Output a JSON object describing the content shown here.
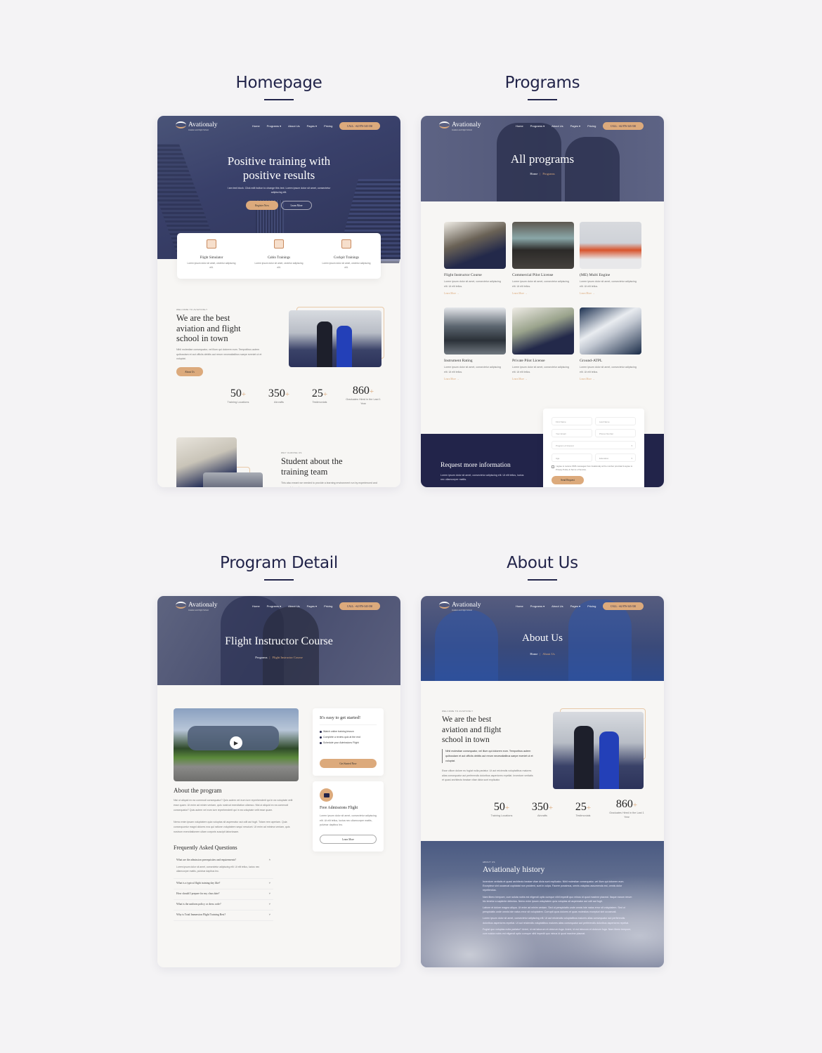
{
  "colors": {
    "navy": "#22244a",
    "accent": "#dcaa7c",
    "background": "#f4f3f5"
  },
  "sections": {
    "homepage": "Homepage",
    "programs": "Programs",
    "program_detail": "Program Detail",
    "about": "About Us"
  },
  "nav": {
    "logo": "Avationaly",
    "logo_sub": "Aviation and Flight School",
    "items": [
      "Home",
      "Programs ▾",
      "About Us",
      "Pages ▾",
      "Pricing"
    ],
    "call": "CALL: +62 876-343-330"
  },
  "homepage": {
    "hero_title_1": "Positive training with",
    "hero_title_2": "positive results",
    "hero_text": "I am text block. Click edit button to change this text. Lorem ipsum dolor sit amet, consectetur adipiscing elit.",
    "register": "Register Now",
    "learn": "Learn More",
    "features": [
      {
        "icon": "flight-simulator-icon",
        "title": "Flight Simulator",
        "text": "Lorem ipsum dolor sit amet, cectetur adipiscing elit."
      },
      {
        "icon": "cabin-seats-icon",
        "title": "Cabin Trainings",
        "text": "Lorem ipsum dolor sit amet, cectetur adipiscing elit."
      },
      {
        "icon": "cockpit-icon",
        "title": "Cockpit Trainings",
        "text": "Lorem ipsum dolor sit amet, cectetur adipiscing elit."
      }
    ],
    "welcome_label": "WELCOME TO AVIATIONLY",
    "welcome_title": "We are the best aviation and flight school in town",
    "welcome_text": "Nihil molestiae consequatur, vel illum qui dolorem eum. Tempotibus autem quibusdam et aut officiis debitis aut rerum necessitatibus saepe eveniet ut et voluptat.",
    "about_btn": "About Us",
    "why_label": "WHY CHOOSE US",
    "why_title": "Student about the training team",
    "why_text": "This also meant we needed to provide a learning environment run by experienced and successful coaches."
  },
  "stats": [
    {
      "num": "50",
      "label": "Training Locations"
    },
    {
      "num": "350",
      "label": "Aircrafts"
    },
    {
      "num": "25",
      "label": "Testimonials"
    },
    {
      "num": "860",
      "label": "Graduates Hired in the Last 1 Year"
    }
  ],
  "programs": {
    "title": "All programs",
    "crumb_home": "Home",
    "crumb_current": "Programs",
    "items": [
      {
        "title": "Flight Instructor Course",
        "text": "Lorem ipsum dolor sit amet, consectetur adipiscing elit. Ut elit tellus.",
        "link": "Learn More →"
      },
      {
        "title": "Commercial Pilot License",
        "text": "Lorem ipsum dolor sit amet, consectetur adipiscing elit. Ut elit tellus.",
        "link": "Learn More →"
      },
      {
        "title": "(ME) Multi Engine",
        "text": "Lorem ipsum dolor sit amet, consectetur adipiscing elit. Ut elit tellus.",
        "link": "Learn More →"
      },
      {
        "title": "Instrument Rating",
        "text": "Lorem ipsum dolor sit amet, consectetur adipiscing elit. Ut elit tellus.",
        "link": "Learn More →"
      },
      {
        "title": "Private Pilot License",
        "text": "Lorem ipsum dolor sit amet, consectetur adipiscing elit. Ut elit tellus.",
        "link": "Learn More →"
      },
      {
        "title": "Ground-ATPL",
        "text": "Lorem ipsum dolor sit amet, consectetur adipiscing elit. Ut elit tellus.",
        "link": "Learn More →"
      }
    ],
    "request_title": "Request more information",
    "request_text": "Lorem ipsum dolor sit amet, consectetur adipiscing elit. Ut elit tellus, luctus nec ullamcorper mattis.",
    "form": {
      "first_name": "First Name",
      "last_name": "Last Name",
      "email": "Your Email",
      "phone": "Phone Number",
      "program": "Program of Interest",
      "age": "Age",
      "education": "Education",
      "consent": "I agree to receive SMS messages from Aviationaly at the number provided & agree to Privacy Policy & Terms of Service.",
      "submit": "Send Request"
    }
  },
  "detail": {
    "title": "Flight Instructor Course",
    "crumb_parent": "Programs",
    "crumb_current": "Flight Instructor Course",
    "about_title": "About the program",
    "about_p1": "Nisi ut aliquid ex ea commodi consequatur? Quis autem vel eum iure reprehenderit qui in ea voluptate velit esse quam. Ut enim ad minim veniam, quis nostrud exercitation ullamco. Nisi ut aliquid ex ea commodi consequatur? Quis autem vel eum iure reprehenderit qui in ea voluptate velit esse quam.",
    "about_p2": "Nemo enim ipsam voluptatem quia voluptas sit aspernatur aut odit aut fugit. Totam rem aperiam. Quia consequuntur magni dolores eos qui ratione voluptatem sequi nesciunt. Ut enim ad minima veniam, quis nostrum exercitationem ullam corporis suscipit laboriosam.",
    "faq_title": "Frequently Asked Questions",
    "faq": [
      {
        "q": "What are the admission prerequisites and requirements?",
        "a": "Lorem ipsum dolor sit amet, consectetur adipiscing elit. Ut elit tellus, luctus nec ullamcorper mattis, pulvinar dapibus leo.",
        "open": true
      },
      {
        "q": "What is a typical flight training day like?",
        "open": false
      },
      {
        "q": "How should I prepare for my class date?",
        "open": false
      },
      {
        "q": "What is the uniform policy or dress code?",
        "open": false
      },
      {
        "q": "Why is Total Immersion Flight Training Best?",
        "open": false
      }
    ],
    "start_title": "It's easy to get started!",
    "start_items": [
      "Watch online training lesson",
      "Complete a review quiz at the end",
      "Schedule your Admissions Flight"
    ],
    "start_btn": "Get Started Now",
    "free_title": "Free Admissions Flight",
    "free_text": "Lorem ipsum dolor sit amet, consectetur adipiscing elit. Ut elit tellus, luctus nec ullamcorper mattis, pulvinar dapibus leo.",
    "free_btn": "Learn More"
  },
  "about": {
    "title": "About Us",
    "crumb_home": "Home",
    "crumb_current": "About Us",
    "welcome_label": "WELCOME TO AVIATIONLY",
    "welcome_title": "We are the best aviation and flight school in town",
    "quote": "Nihil molestiae consequatur, vel illum qui dolorem eum. Temporibus autem quibusdam et aut officiis debitis aut rerum necessitatibus saepe eveniet ut et voluptat.",
    "text": "Esse cillum dolore eu fugiat nulla pariatur. Ut aut reiciendis voluptatibus maiores alias consequatur aut perferendis doloribus asperiores repellat. Inventore veritatis et quasi architecto beatae vitae dicta sunt explicabo",
    "history_label": "ABOUT US",
    "history_title": "Aviationaly history",
    "history_paras": [
      "Inventore veritatis et quasi architecto beatae vitae dicta sunt explicabo. Nihil molestiae consequatur, vel illum qui dolorem eum. Excepteur sint occaecat cupidatat non proident, sunt in culpa. Facere possimus, omnis voluptas assumenda est, omnis dolor repellendus.",
      "Nam libero tempore, cum soluta nobis est eligendi optio cumque nihil impedit quo minus id quod maxime placeat. Itaque earum rerum hic tenetur a sapiente delectus. Nemo enim ipsam voluptatem quia voluptas sit aspernatur aut odit aut fugit.",
      "Labore et dolore magna aliqua. Ut enim ad minim veniam. Sed ut perspiciatis unde omnis iste natus error sit voluptatem. Sed ut perspiciatis unde omnis iste natus error sit voluptatem. Corrupti quos dolores et quas molestias excepturi sint occaecati.",
      "Lorem ipsum dolor sit amet, consectetur adipiscing elit. Ut aut reiciendis voluptatibus maiores alias consequatur aut perferendis doloribus asperiores repellat. Ut aut reiciendis voluptatibus maiores alias consequatur aut perferendis doloribus asperiores repellat.",
      "Fugiat quo voluptas nulla pariatur? Animi, id est laborum et dolorum fuga. Animi, id est laborum et dolorum fuga. Nam libero tempore, cum soluta nobis est eligendi optio cumque nihil impedit quo minus id quod maxime placeat."
    ]
  }
}
